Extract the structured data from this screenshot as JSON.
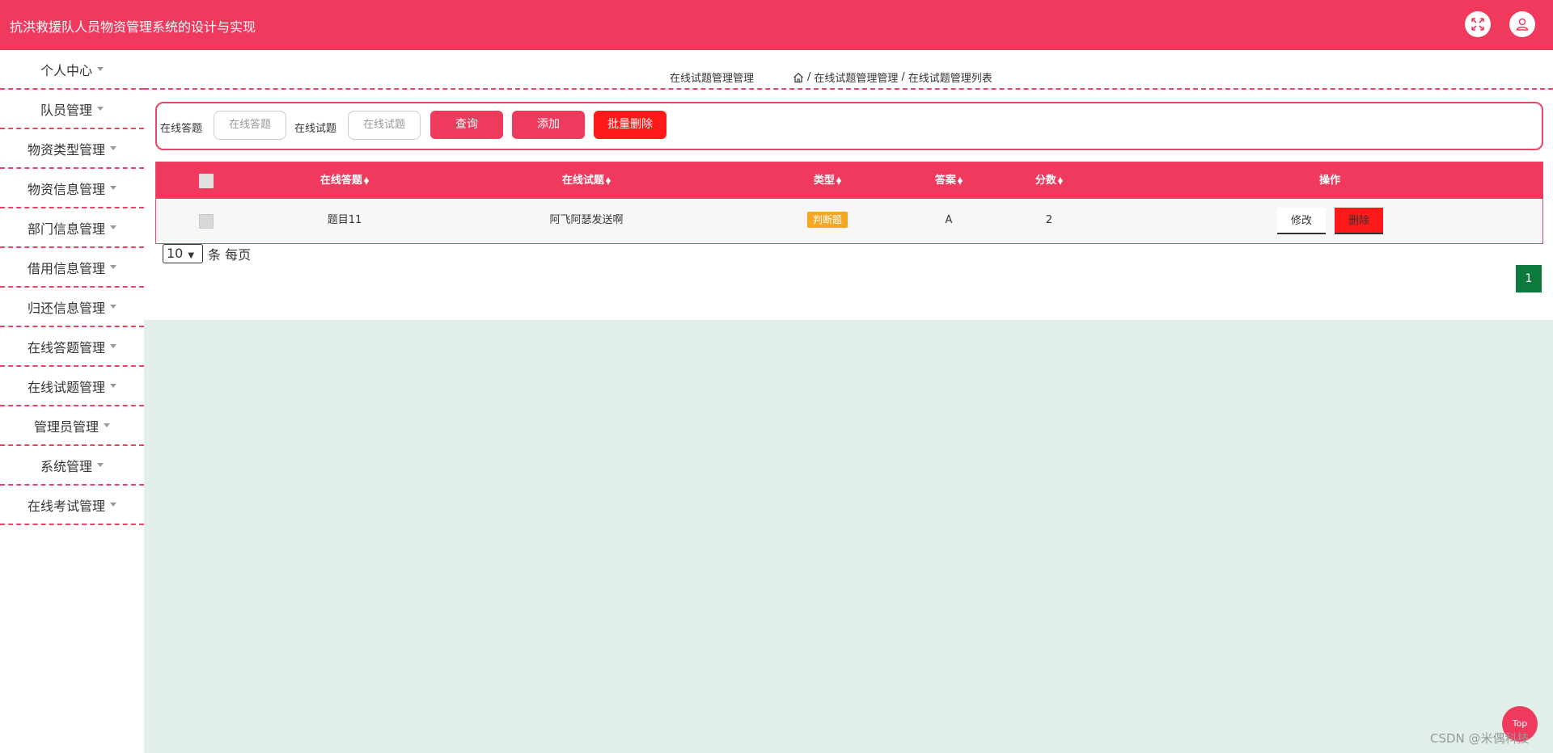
{
  "app": {
    "title": "抗洪救援队人员物资管理系统的设计与实现"
  },
  "header": {
    "fullscreen_icon": "fullscreen-icon",
    "user_icon": "user-icon"
  },
  "sidebar": {
    "items": [
      {
        "label": "个人中心"
      },
      {
        "label": "队员管理"
      },
      {
        "label": "物资类型管理"
      },
      {
        "label": "物资信息管理"
      },
      {
        "label": "部门信息管理"
      },
      {
        "label": "借用信息管理"
      },
      {
        "label": "归还信息管理"
      },
      {
        "label": "在线答题管理"
      },
      {
        "label": "在线试题管理"
      },
      {
        "label": "管理员管理"
      },
      {
        "label": "系统管理"
      },
      {
        "label": "在线考试管理"
      }
    ]
  },
  "breadcrumb": {
    "page_title": "在线试题管理管理",
    "home_icon": "home-icon",
    "level1": "在线试题管理管理",
    "level2": "在线试题管理列表",
    "sep": "/"
  },
  "search": {
    "label_answer": "在线答题",
    "placeholder_answer": "在线答题",
    "label_question": "在线试题",
    "placeholder_question": "在线试题",
    "query_btn": "查询",
    "add_btn": "添加",
    "batch_delete_btn": "批量删除"
  },
  "table": {
    "headers": {
      "answer": "在线答题",
      "question": "在线试题",
      "type": "类型",
      "correct": "答案",
      "score": "分数",
      "ops": "操作"
    },
    "rows": [
      {
        "answer": "题目11",
        "question": "阿飞阿瑟发送啊",
        "type": "判断题",
        "correct": "A",
        "score": "2",
        "edit": "修改",
        "delete": "删除"
      }
    ]
  },
  "pagination": {
    "page_size": "10",
    "per_page_label": "条 每页",
    "current_page": "1"
  },
  "colors": {
    "primary": "#ef3a5d",
    "danger": "#ff1a1a",
    "tag": "#f5a623",
    "page_active": "#0d7a3e",
    "content_bg": "#e2efe8"
  },
  "back_to_top": "Top",
  "watermark": "CSDN @米偶科技"
}
